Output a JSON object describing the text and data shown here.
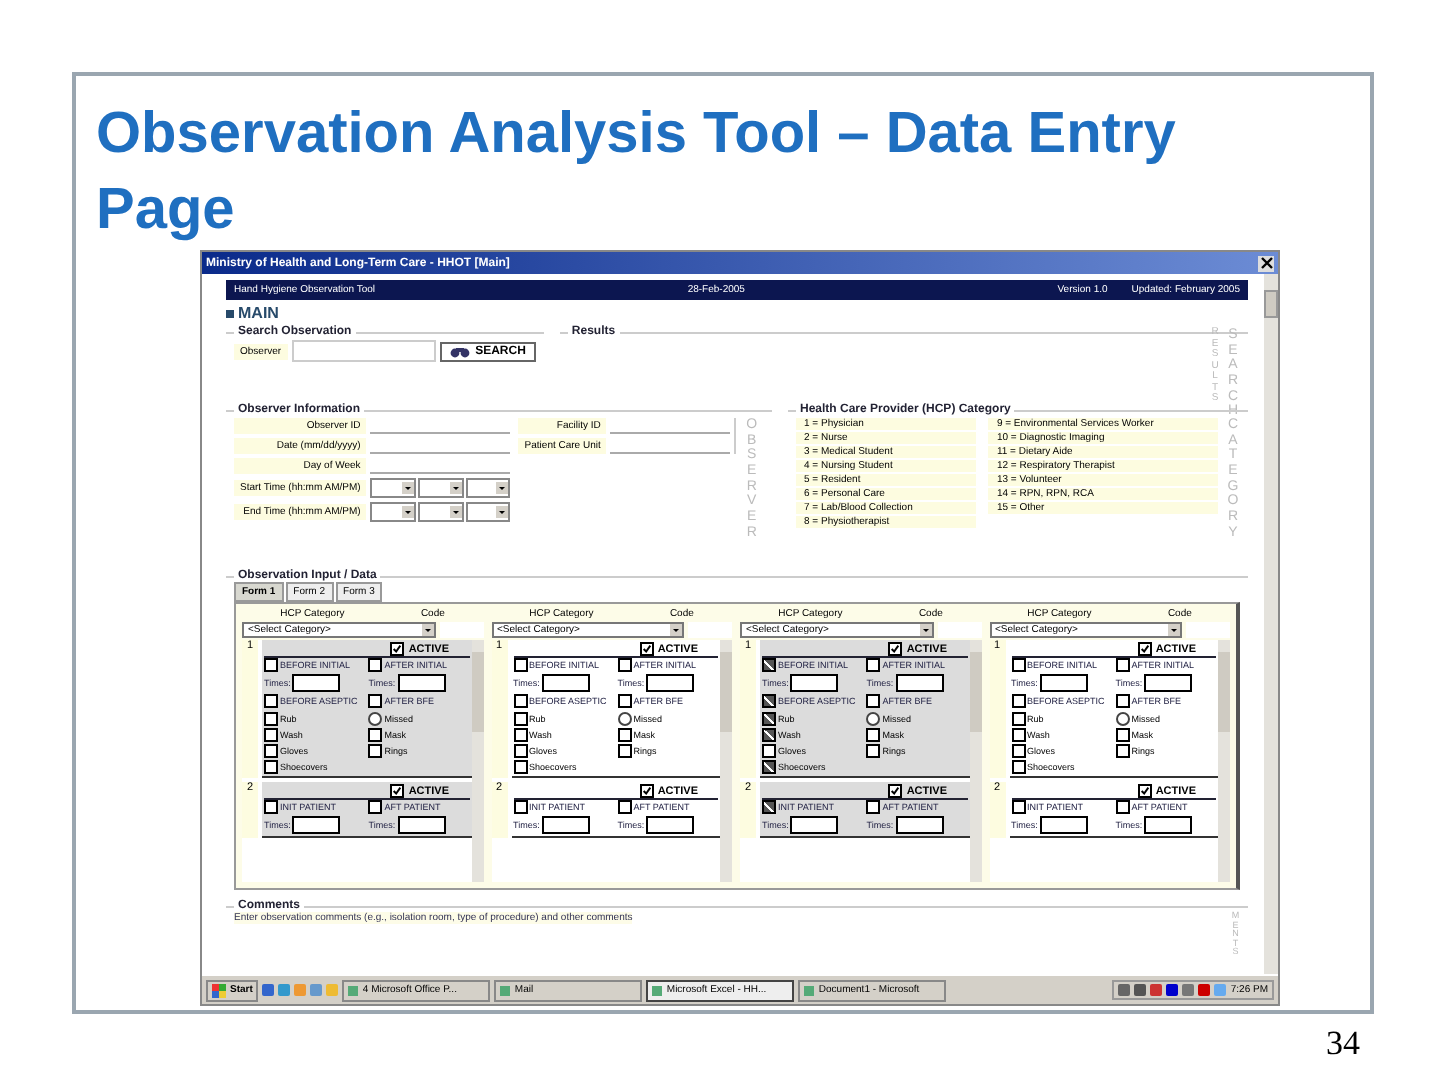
{
  "slide": {
    "title": "Observation Analysis Tool – Data Entry Page",
    "page_number": "34"
  },
  "window": {
    "title": "Ministry of Health and Long-Term Care - HHOT [Main]"
  },
  "header": {
    "left": "Hand Hygiene Observation Tool",
    "center": "28-Feb-2005",
    "version": "Version 1.0",
    "updated": "Updated: February 2005"
  },
  "main_label": "MAIN",
  "search": {
    "legend": "Search Observation",
    "label": "Observer",
    "button": "SEARCH"
  },
  "results": {
    "legend": "Results",
    "side_labels": [
      "RESULTS",
      "SEARCH"
    ]
  },
  "observer": {
    "legend": "Observer Information",
    "side_label": "OBSERVER",
    "fields": [
      "Observer ID",
      "Date (mm/dd/yyyy)",
      "Day of Week"
    ],
    "facility": [
      "Facility ID",
      "Patient Care Unit"
    ],
    "times": [
      "Start Time (hh:mm AM/PM)",
      "End Time (hh:mm AM/PM)"
    ]
  },
  "category": {
    "legend": "Health Care Provider (HCP) Category",
    "side_label": "CATEGORY",
    "items": [
      "1 = Physician",
      "2 = Nurse",
      "3 = Medical Student",
      "4 = Nursing Student",
      "5 = Resident",
      "6 = Personal Care",
      "7 = Lab/Blood Collection",
      "8 = Physiotherapist",
      "9 = Environmental Services Worker",
      "10 = Diagnostic Imaging",
      "11 = Dietary Aide",
      "12 = Respiratory Therapist",
      "13 = Volunteer",
      "14 = RPN, RPN, RCA",
      "15 = Other"
    ]
  },
  "observation": {
    "legend": "Observation Input / Data",
    "tabs": [
      {
        "label": "Form 1",
        "selected": true
      },
      {
        "label": "Form 2",
        "selected": false
      },
      {
        "label": "Form 3",
        "selected": false
      }
    ],
    "columns": [
      {
        "category_label": "HCP Category",
        "code_label": "Code",
        "select": "<Select Category>",
        "entries": [
          {
            "number": "1",
            "active": true,
            "active_label": "ACTIVE",
            "checks": [
              {
                "label": "BEFORE INITIAL",
                "checked": false
              },
              {
                "label": "AFTER INITIAL",
                "checked": false
              }
            ],
            "times": [
              "Times:",
              "Times:"
            ],
            "checks2": [
              {
                "label": "BEFORE ASEPTIC",
                "checked": false
              },
              {
                "label": "AFTER BFE",
                "checked": false
              }
            ],
            "methods": [
              {
                "label": "Rub",
                "checked": false
              },
              {
                "label": "Wash",
                "checked": false
              },
              {
                "label": "Gloves",
                "checked": false
              },
              {
                "label": "Shoecovers",
                "checked": false
              }
            ],
            "missed": {
              "label": "Missed",
              "selected": false
            },
            "extras": [
              {
                "label": "Mask",
                "checked": false
              },
              {
                "label": "Rings",
                "checked": false
              }
            ]
          },
          {
            "number": "2",
            "active": true,
            "active_label": "ACTIVE",
            "checks": [
              {
                "label": "INIT PATIENT",
                "checked": false
              },
              {
                "label": "AFT PATIENT",
                "checked": false
              }
            ],
            "times": [
              "Times:",
              "Times:"
            ]
          }
        ]
      },
      {
        "category_label": "HCP Category",
        "code_label": "Code",
        "select": "<Select Category>",
        "entries": [
          {
            "number": "1",
            "active": true,
            "active_label": "ACTIVE",
            "checks": [
              {
                "label": "BEFORE INITIAL",
                "checked": false
              },
              {
                "label": "AFTER INITIAL",
                "checked": false
              }
            ],
            "times": [
              "Times:",
              "Times:"
            ],
            "checks2": [
              {
                "label": "BEFORE ASEPTIC",
                "checked": false
              },
              {
                "label": "AFTER BFE",
                "checked": false
              }
            ],
            "methods": [
              {
                "label": "Rub",
                "checked": false
              },
              {
                "label": "Wash",
                "checked": false
              },
              {
                "label": "Gloves",
                "checked": false
              },
              {
                "label": "Shoecovers",
                "checked": false
              }
            ],
            "missed": {
              "label": "Missed",
              "selected": false
            },
            "extras": [
              {
                "label": "Mask",
                "checked": false
              },
              {
                "label": "Rings",
                "checked": false
              }
            ]
          },
          {
            "number": "2",
            "active": true,
            "active_label": "ACTIVE",
            "checks": [
              {
                "label": "INIT PATIENT",
                "checked": false
              },
              {
                "label": "AFT PATIENT",
                "checked": false
              }
            ],
            "times": [
              "Times:",
              "Times:"
            ]
          }
        ]
      },
      {
        "category_label": "HCP Category",
        "code_label": "Code",
        "select": "<Select Category>",
        "entries": [
          {
            "number": "1",
            "active": true,
            "active_label": "ACTIVE",
            "checks": [
              {
                "label": "BEFORE INITIAL",
                "checked": true
              },
              {
                "label": "AFTER INITIAL",
                "checked": false
              }
            ],
            "times": [
              "Times:",
              "Times:"
            ],
            "checks2": [
              {
                "label": "BEFORE ASEPTIC",
                "checked": true
              },
              {
                "label": "AFTER BFE",
                "checked": false
              }
            ],
            "methods": [
              {
                "label": "Rub",
                "checked": true
              },
              {
                "label": "Wash",
                "checked": true
              },
              {
                "label": "Gloves",
                "checked": false
              },
              {
                "label": "Shoecovers",
                "checked": true
              }
            ],
            "missed": {
              "label": "Missed",
              "selected": false
            },
            "extras": [
              {
                "label": "Mask",
                "checked": false
              },
              {
                "label": "Rings",
                "checked": false
              }
            ]
          },
          {
            "number": "2",
            "active": true,
            "active_label": "ACTIVE",
            "checks": [
              {
                "label": "INIT PATIENT",
                "checked": true
              },
              {
                "label": "AFT PATIENT",
                "checked": false
              }
            ],
            "times": [
              "Times:",
              "Times:"
            ]
          }
        ]
      },
      {
        "category_label": "HCP Category",
        "code_label": "Code",
        "select": "<Select Category>",
        "entries": [
          {
            "number": "1",
            "active": true,
            "active_label": "ACTIVE",
            "checks": [
              {
                "label": "BEFORE INITIAL",
                "checked": false
              },
              {
                "label": "AFTER INITIAL",
                "checked": false
              }
            ],
            "times": [
              "Times:",
              "Times:"
            ],
            "checks2": [
              {
                "label": "BEFORE ASEPTIC",
                "checked": false
              },
              {
                "label": "AFTER BFE",
                "checked": false
              }
            ],
            "methods": [
              {
                "label": "Rub",
                "checked": false
              },
              {
                "label": "Wash",
                "checked": false
              },
              {
                "label": "Gloves",
                "checked": false
              },
              {
                "label": "Shoecovers",
                "checked": false
              }
            ],
            "missed": {
              "label": "Missed",
              "selected": false
            },
            "extras": [
              {
                "label": "Mask",
                "checked": false
              },
              {
                "label": "Rings",
                "checked": false
              }
            ]
          },
          {
            "number": "2",
            "active": true,
            "active_label": "ACTIVE",
            "checks": [
              {
                "label": "INIT PATIENT",
                "checked": false
              },
              {
                "label": "AFT PATIENT",
                "checked": false
              }
            ],
            "times": [
              "Times:",
              "Times:"
            ]
          }
        ]
      }
    ]
  },
  "comments": {
    "legend": "Comments",
    "text": "Enter observation comments (e.g., isolation room, type of procedure) and other comments",
    "side_label": "MENTS"
  },
  "taskbar": {
    "start": "Start",
    "buttons": [
      {
        "label": "4 Microsoft Office P...",
        "selected": false
      },
      {
        "label": "Mail",
        "selected": false
      },
      {
        "label": "Microsoft Excel - HH...",
        "selected": true
      },
      {
        "label": "Document1 - Microsoft",
        "selected": false
      }
    ],
    "clock": "7:26 PM"
  }
}
